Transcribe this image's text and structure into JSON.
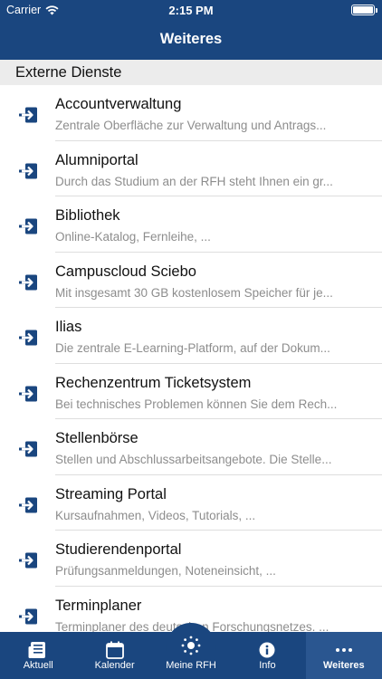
{
  "status_bar": {
    "carrier": "Carrier",
    "time": "2:15 PM"
  },
  "nav": {
    "title": "Weiteres"
  },
  "section": {
    "title": "Externe Dienste"
  },
  "items": [
    {
      "title": "Accountverwaltung",
      "subtitle": "Zentrale Oberfläche zur Verwaltung und Antrags..."
    },
    {
      "title": "Alumniportal",
      "subtitle": "Durch das Studium an der RFH steht Ihnen ein gr..."
    },
    {
      "title": "Bibliothek",
      "subtitle": "Online-Katalog, Fernleihe, ..."
    },
    {
      "title": "Campuscloud Sciebo",
      "subtitle": "Mit insgesamt 30 GB kostenlosem Speicher für je..."
    },
    {
      "title": "Ilias",
      "subtitle": "Die zentrale E-Learning-Platform, auf der Dokum..."
    },
    {
      "title": "Rechenzentrum Ticketsystem",
      "subtitle": "Bei technisches Problemen können Sie dem Rech..."
    },
    {
      "title": "Stellenbörse",
      "subtitle": "Stellen und Abschlussarbeitsangebote. Die Stelle..."
    },
    {
      "title": "Streaming Portal",
      "subtitle": "Kursaufnahmen, Videos, Tutorials, ..."
    },
    {
      "title": "Studierendenportal",
      "subtitle": "Prüfungsanmeldungen, Noteneinsicht, ..."
    },
    {
      "title": "Terminplaner",
      "subtitle": "Terminplaner des deutschen Forschungsnetzes. ..."
    }
  ],
  "tabs": [
    {
      "label": "Aktuell",
      "icon": "news-icon"
    },
    {
      "label": "Kalender",
      "icon": "calendar-icon"
    },
    {
      "label": "Meine RFH",
      "icon": "logo-icon"
    },
    {
      "label": "Info",
      "icon": "info-icon"
    },
    {
      "label": "Weiteres",
      "icon": "more-icon",
      "active": true
    }
  ],
  "colors": {
    "brand": "#1a467f",
    "active_tab": "#2a5690",
    "section_bg": "#ececec"
  }
}
